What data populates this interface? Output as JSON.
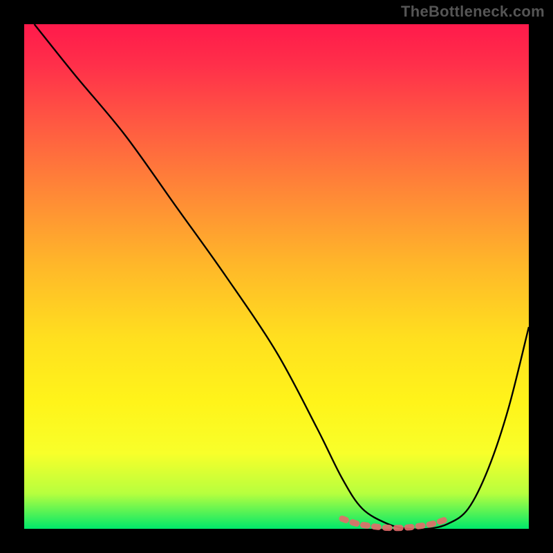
{
  "watermark": "TheBottleneck.com",
  "colors": {
    "page_bg": "#000000",
    "curve": "#000000",
    "marker_stroke": "#e46a6a",
    "marker_fill": "#e46a6a",
    "gradient_top": "#ff1a4b",
    "gradient_bottom": "#00e86a"
  },
  "chart_data": {
    "type": "line",
    "title": "",
    "xlabel": "",
    "ylabel": "",
    "xlim": [
      0,
      100
    ],
    "ylim": [
      0,
      100
    ],
    "grid": false,
    "legend": false,
    "series": [
      {
        "name": "bottleneck-curve",
        "x": [
          2,
          10,
          20,
          30,
          40,
          50,
          58,
          63,
          67,
          72,
          76,
          80,
          84,
          88,
          92,
          96,
          100
        ],
        "y": [
          100,
          90,
          78,
          64,
          50,
          35,
          20,
          10,
          4,
          1,
          0,
          0,
          1,
          4,
          12,
          24,
          40
        ]
      }
    ],
    "markers": {
      "name": "flat-minimum",
      "x": [
        63,
        66,
        69,
        72,
        75,
        78,
        81,
        84
      ],
      "y": [
        2,
        1,
        0.5,
        0.2,
        0.2,
        0.5,
        1,
        2
      ]
    }
  }
}
